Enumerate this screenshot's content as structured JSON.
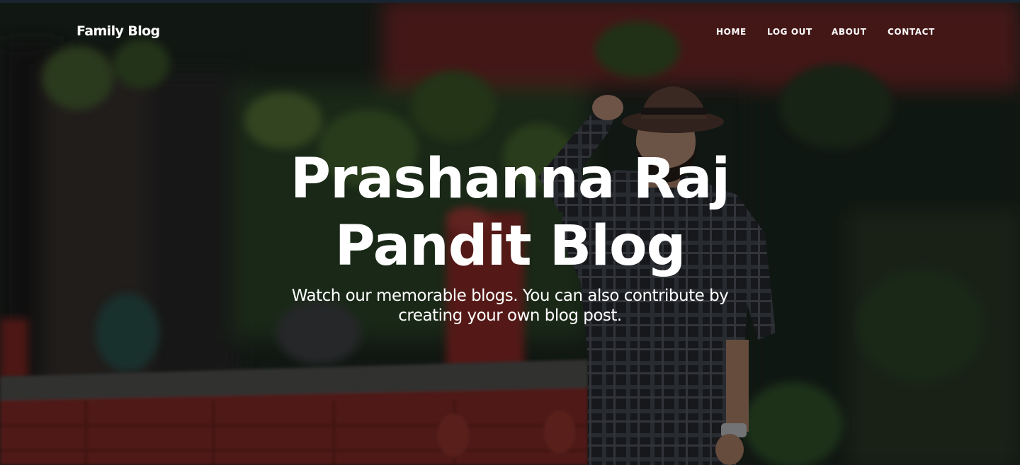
{
  "navbar": {
    "brand": "Family Blog",
    "links": [
      {
        "label": "HOME"
      },
      {
        "label": "LOG OUT"
      },
      {
        "label": "ABOUT"
      },
      {
        "label": "CONTACT"
      }
    ]
  },
  "hero": {
    "heading": "Prashanna Raj Pandit Blog",
    "subheading": "Watch our memorable blogs. You can also contribute by creating your own blog post."
  },
  "theme": {
    "text_color": "#ffffff",
    "overlay_color": "#000000",
    "foliage_color": "#2f5a2a",
    "brick_red": "#8f2f2a"
  }
}
